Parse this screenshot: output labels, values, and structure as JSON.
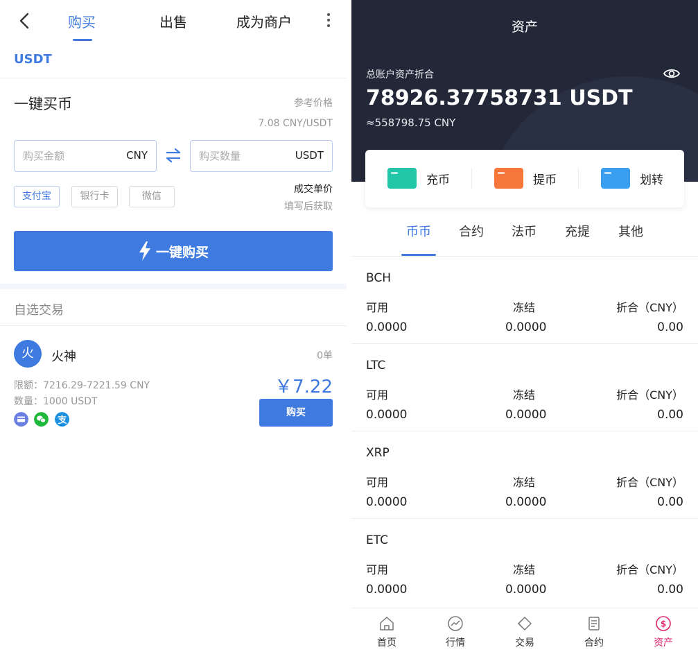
{
  "left": {
    "tabs": [
      {
        "label": "购买",
        "active": true
      },
      {
        "label": "出售",
        "active": false
      },
      {
        "label": "成为商户",
        "active": false
      }
    ],
    "coin": "USDT",
    "quick_buy": {
      "title": "一键买币",
      "ref_label": "参考价格",
      "ref_price": "7.08 CNY/USDT",
      "amount_placeholder": "购买金额",
      "amount_unit": "CNY",
      "qty_placeholder": "购买数量",
      "qty_unit": "USDT",
      "pay_methods": [
        "支付宝",
        "银行卡",
        "微信"
      ],
      "deal_label": "成交单价",
      "deal_sub": "填写后获取",
      "button": "一键购买"
    },
    "section_title": "自选交易",
    "merchant": {
      "avatar_char": "火",
      "name": "火神",
      "orders": "0单",
      "limit": "限额：7216.29-7221.59 CNY",
      "qty": "数量：1000 USDT",
      "price": "￥7.22",
      "button": "购买",
      "pay_icons": [
        "bank-card-icon",
        "wechat-icon",
        "alipay-icon"
      ]
    }
  },
  "right": {
    "title": "资产",
    "total_label": "总账户资产折合",
    "total_value": "78926.37758731 USDT",
    "total_cny": "≈558798.75 CNY",
    "actions": [
      {
        "label": "充币",
        "color": "#21c7a8"
      },
      {
        "label": "提币",
        "color": "#f7763a"
      },
      {
        "label": "划转",
        "color": "#3a9ef0"
      }
    ],
    "tabs": [
      {
        "label": "币币",
        "active": true
      },
      {
        "label": "合约",
        "active": false
      },
      {
        "label": "法币",
        "active": false
      },
      {
        "label": "充提",
        "active": false
      },
      {
        "label": "其他",
        "active": false
      }
    ],
    "columns": [
      "可用",
      "冻结",
      "折合（CNY）"
    ],
    "coins": [
      {
        "name": "BCH",
        "available": "0.0000",
        "frozen": "0.0000",
        "cny": "0.00"
      },
      {
        "name": "LTC",
        "available": "0.0000",
        "frozen": "0.0000",
        "cny": "0.00"
      },
      {
        "name": "XRP",
        "available": "0.0000",
        "frozen": "0.0000",
        "cny": "0.00"
      },
      {
        "name": "ETC",
        "available": "0.0000",
        "frozen": "0.0000",
        "cny": "0.00"
      }
    ],
    "nav": [
      {
        "label": "首页",
        "icon": "home-icon",
        "active": false
      },
      {
        "label": "行情",
        "icon": "market-icon",
        "active": false
      },
      {
        "label": "交易",
        "icon": "trade-icon",
        "active": false
      },
      {
        "label": "合约",
        "icon": "contract-icon",
        "active": false
      },
      {
        "label": "资产",
        "icon": "assets-icon",
        "active": true
      }
    ],
    "accent_color": "#3f7ae0",
    "active_nav_color": "#e0246b"
  }
}
